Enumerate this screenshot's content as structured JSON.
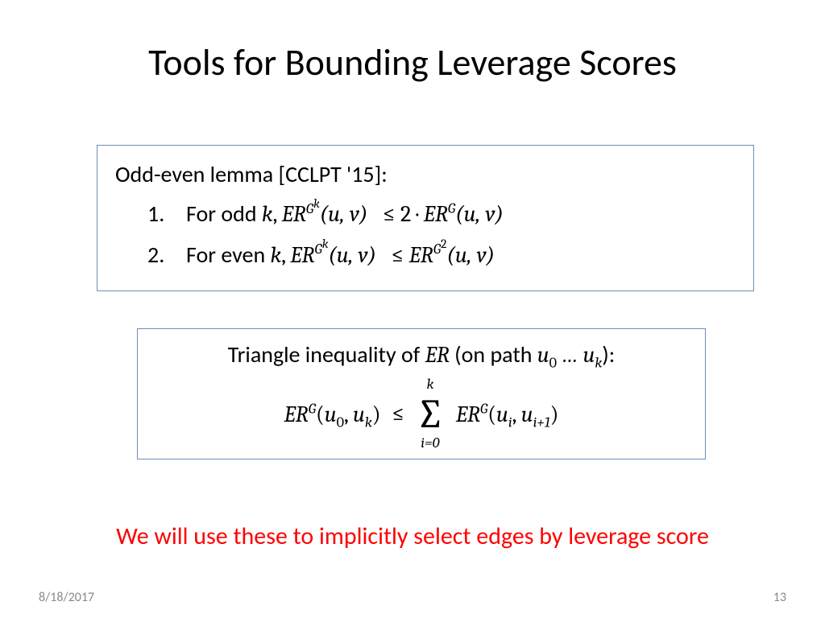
{
  "title": "Tools for Bounding Leverage Scores",
  "box1": {
    "heading": "Odd-even lemma [CCLPT '15]:",
    "item1_num": "1.",
    "item1_prefix": "For odd ",
    "item2_num": "2.",
    "item2_prefix": "For even "
  },
  "box2": {
    "heading_prefix": "Triangle inequality of ",
    "heading_mid": " (on path ",
    "heading_suffix": "):"
  },
  "note": "We will use these to implicitly select edges by leverage score",
  "footer": {
    "date": "8/18/2017",
    "page": "13"
  },
  "math": {
    "k": "k",
    "ER": "ER",
    "G": "G",
    "Gk": "k",
    "G2": "2",
    "uv": "(u, v)",
    "le": "≤",
    "two_dot": "2 ·",
    "u0": "0",
    "uk": "k",
    "dots": " … ",
    "u": "u",
    "ui": "i",
    "uip1": "i+1",
    "sum_top": "k",
    "sum_bot": "i=0",
    "sum_sym": "∑"
  }
}
